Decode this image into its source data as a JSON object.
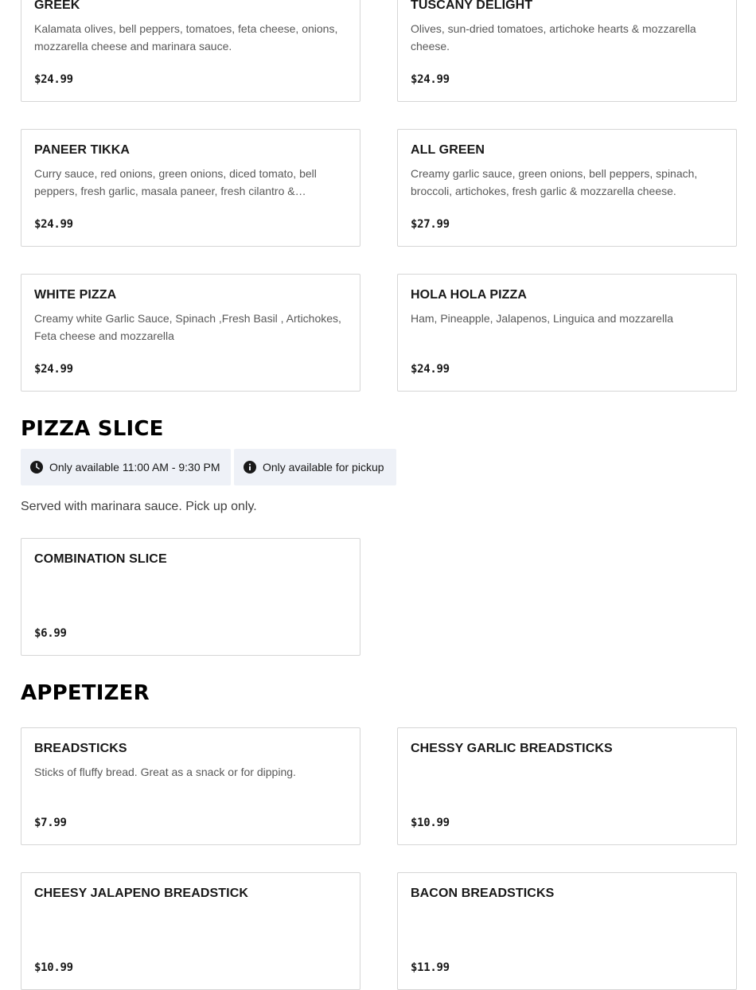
{
  "sections": {
    "pizza_top": {
      "items": [
        {
          "name": "GREEK",
          "desc": "Kalamata olives, bell peppers, tomatoes, feta cheese, onions, mozzarella cheese and marinara sauce.",
          "price": "$24.99"
        },
        {
          "name": "TUSCANY DELIGHT",
          "desc": "Olives, sun-dried tomatoes, artichoke hearts & mozzarella cheese.",
          "price": "$24.99"
        },
        {
          "name": "PANEER TIKKA",
          "desc": "Curry sauce, red onions, green onions, diced tomato, bell peppers, fresh garlic, masala paneer, fresh cilantro &…",
          "price": "$24.99"
        },
        {
          "name": "ALL GREEN",
          "desc": "Creamy garlic sauce, green onions, bell peppers, spinach, broccoli, artichokes, fresh garlic & mozzarella cheese.",
          "price": "$27.99"
        },
        {
          "name": "WHITE PIZZA",
          "desc": "Creamy white Garlic Sauce, Spinach ,Fresh Basil , Artichokes, Feta cheese and mozzarella",
          "price": "$24.99"
        },
        {
          "name": "HOLA HOLA PIZZA",
          "desc": "Ham, Pineapple, Jalapenos, Linguica and mozzarella",
          "price": "$24.99"
        }
      ]
    },
    "pizza_slice": {
      "title": "PIZZA SLICE",
      "availability_hours": "Only available 11:00 AM - 9:30 PM",
      "availability_pickup": "Only available for pickup",
      "note": "Served with marinara sauce. Pick up only.",
      "items": [
        {
          "name": "COMBINATION SLICE",
          "desc": "",
          "price": "$6.99"
        }
      ]
    },
    "appetizer": {
      "title": "APPETIZER",
      "items": [
        {
          "name": "BREADSTICKS",
          "desc": "Sticks of fluffy bread. Great as a snack or for dipping.",
          "price": "$7.99"
        },
        {
          "name": "CHESSY GARLIC BREADSTICKS",
          "desc": "",
          "price": "$10.99"
        },
        {
          "name": "CHEESY JALAPENO BREADSTICK",
          "desc": "",
          "price": "$10.99"
        },
        {
          "name": "BACON BREADSTICKS",
          "desc": "",
          "price": "$11.99"
        }
      ]
    }
  },
  "icons": {
    "clock": "clock-icon",
    "info": "info-icon"
  },
  "colors": {
    "card_border": "#d6d6d6",
    "pill_bg": "#eef1f7",
    "desc_text": "#595959",
    "title_text": "#191919"
  }
}
